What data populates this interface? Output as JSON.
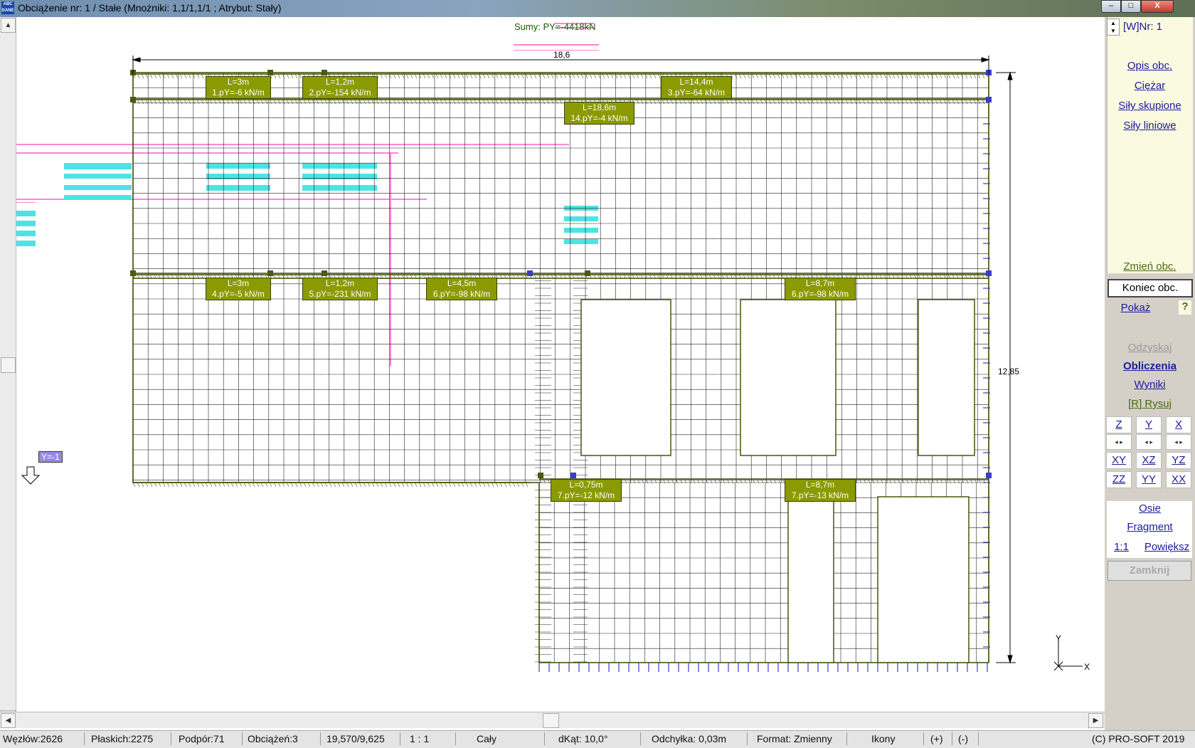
{
  "window": {
    "title": "Obciążenie nr: 1 / Stałe (Mnożniki: 1,1/1,1/1 ; Atrybut: Stały)",
    "app_icon_text": "ABC DANE",
    "minimize_label": "–",
    "maximize_label": "□",
    "close_label": "X"
  },
  "drawing": {
    "sum_label": "Sumy: PY=-4418kN",
    "width_dim": "18,6",
    "height_dim": "12,85",
    "y_marker": "Y=-1",
    "axis_y": "Y",
    "axis_x": "X",
    "loads": [
      {
        "line1": "L=3m",
        "line2": "1.pY=-6 kN/m"
      },
      {
        "line1": "L=1,2m",
        "line2": "2.pY=-154 kN/m"
      },
      {
        "line1": "L=14,4m",
        "line2": "3.pY=-64 kN/m"
      },
      {
        "line1": "L=18,6m",
        "line2": "14.pY=-4 kN/m"
      },
      {
        "line1": "L=3m",
        "line2": "4.pY=-5 kN/m"
      },
      {
        "line1": "L=1,2m",
        "line2": "5.pY=-231 kN/m"
      },
      {
        "line1": "L=4,5m",
        "line2": "6.pY=-98 kN/m"
      },
      {
        "line1": "L=8,7m",
        "line2": "6.pY=-98 kN/m"
      },
      {
        "line1": "L=0,75m",
        "line2": "7.pY=-12 kN/m"
      },
      {
        "line1": "L=8,7m",
        "line2": "7.pY=-13 kN/m"
      }
    ]
  },
  "panel": {
    "spinner_label": "[W]Nr: 1",
    "opis_obc": "Opis obc.",
    "ciezar": "Ciężar",
    "sily_skupione": "Siły skupione",
    "sily_liniowe": "Siły liniowe",
    "zmien_obc": "Zmień obc.",
    "koniec_obc": "Koniec obc.",
    "pokaz": "Pokaż",
    "help": "?",
    "odzyskaj": "Odzyskaj",
    "obliczenia": "Obliczenia",
    "wyniki": "Wyniki",
    "rysuj": "[R] Rysuj",
    "axes_row1": [
      "Z",
      "Y",
      "X"
    ],
    "axes_row2": [
      "XY",
      "XZ",
      "YZ"
    ],
    "axes_row3": [
      "ZZ",
      "YY",
      "XX"
    ],
    "osie": "Osie",
    "fragment": "Fragment",
    "scale_1_1": "1:1",
    "powieksz": "Powiększ",
    "zamknij": "Zamknij"
  },
  "status": {
    "nodes": "Węzłów:2626",
    "flat": "Płaskich:2275",
    "supports": "Podpór:71",
    "loads": "Obciążeń:3",
    "coords": "19,570/9,625",
    "scale": "1 : 1",
    "view": "Cały",
    "dkat": "dKąt: 10,0°",
    "deviation": "Odchyłka: 0,03m",
    "format": "Format: Zmienny",
    "icons": "Ikony",
    "plus": "(+)",
    "minus": "(-)",
    "copyright": "(C) PRO-SOFT 2019"
  },
  "colors": {
    "load_box": "#8a9a00",
    "mesh": "#000000",
    "support": "#3a3ad0",
    "ghost_pink": "#ff66cc",
    "ghost_cyan": "#22dddd"
  }
}
